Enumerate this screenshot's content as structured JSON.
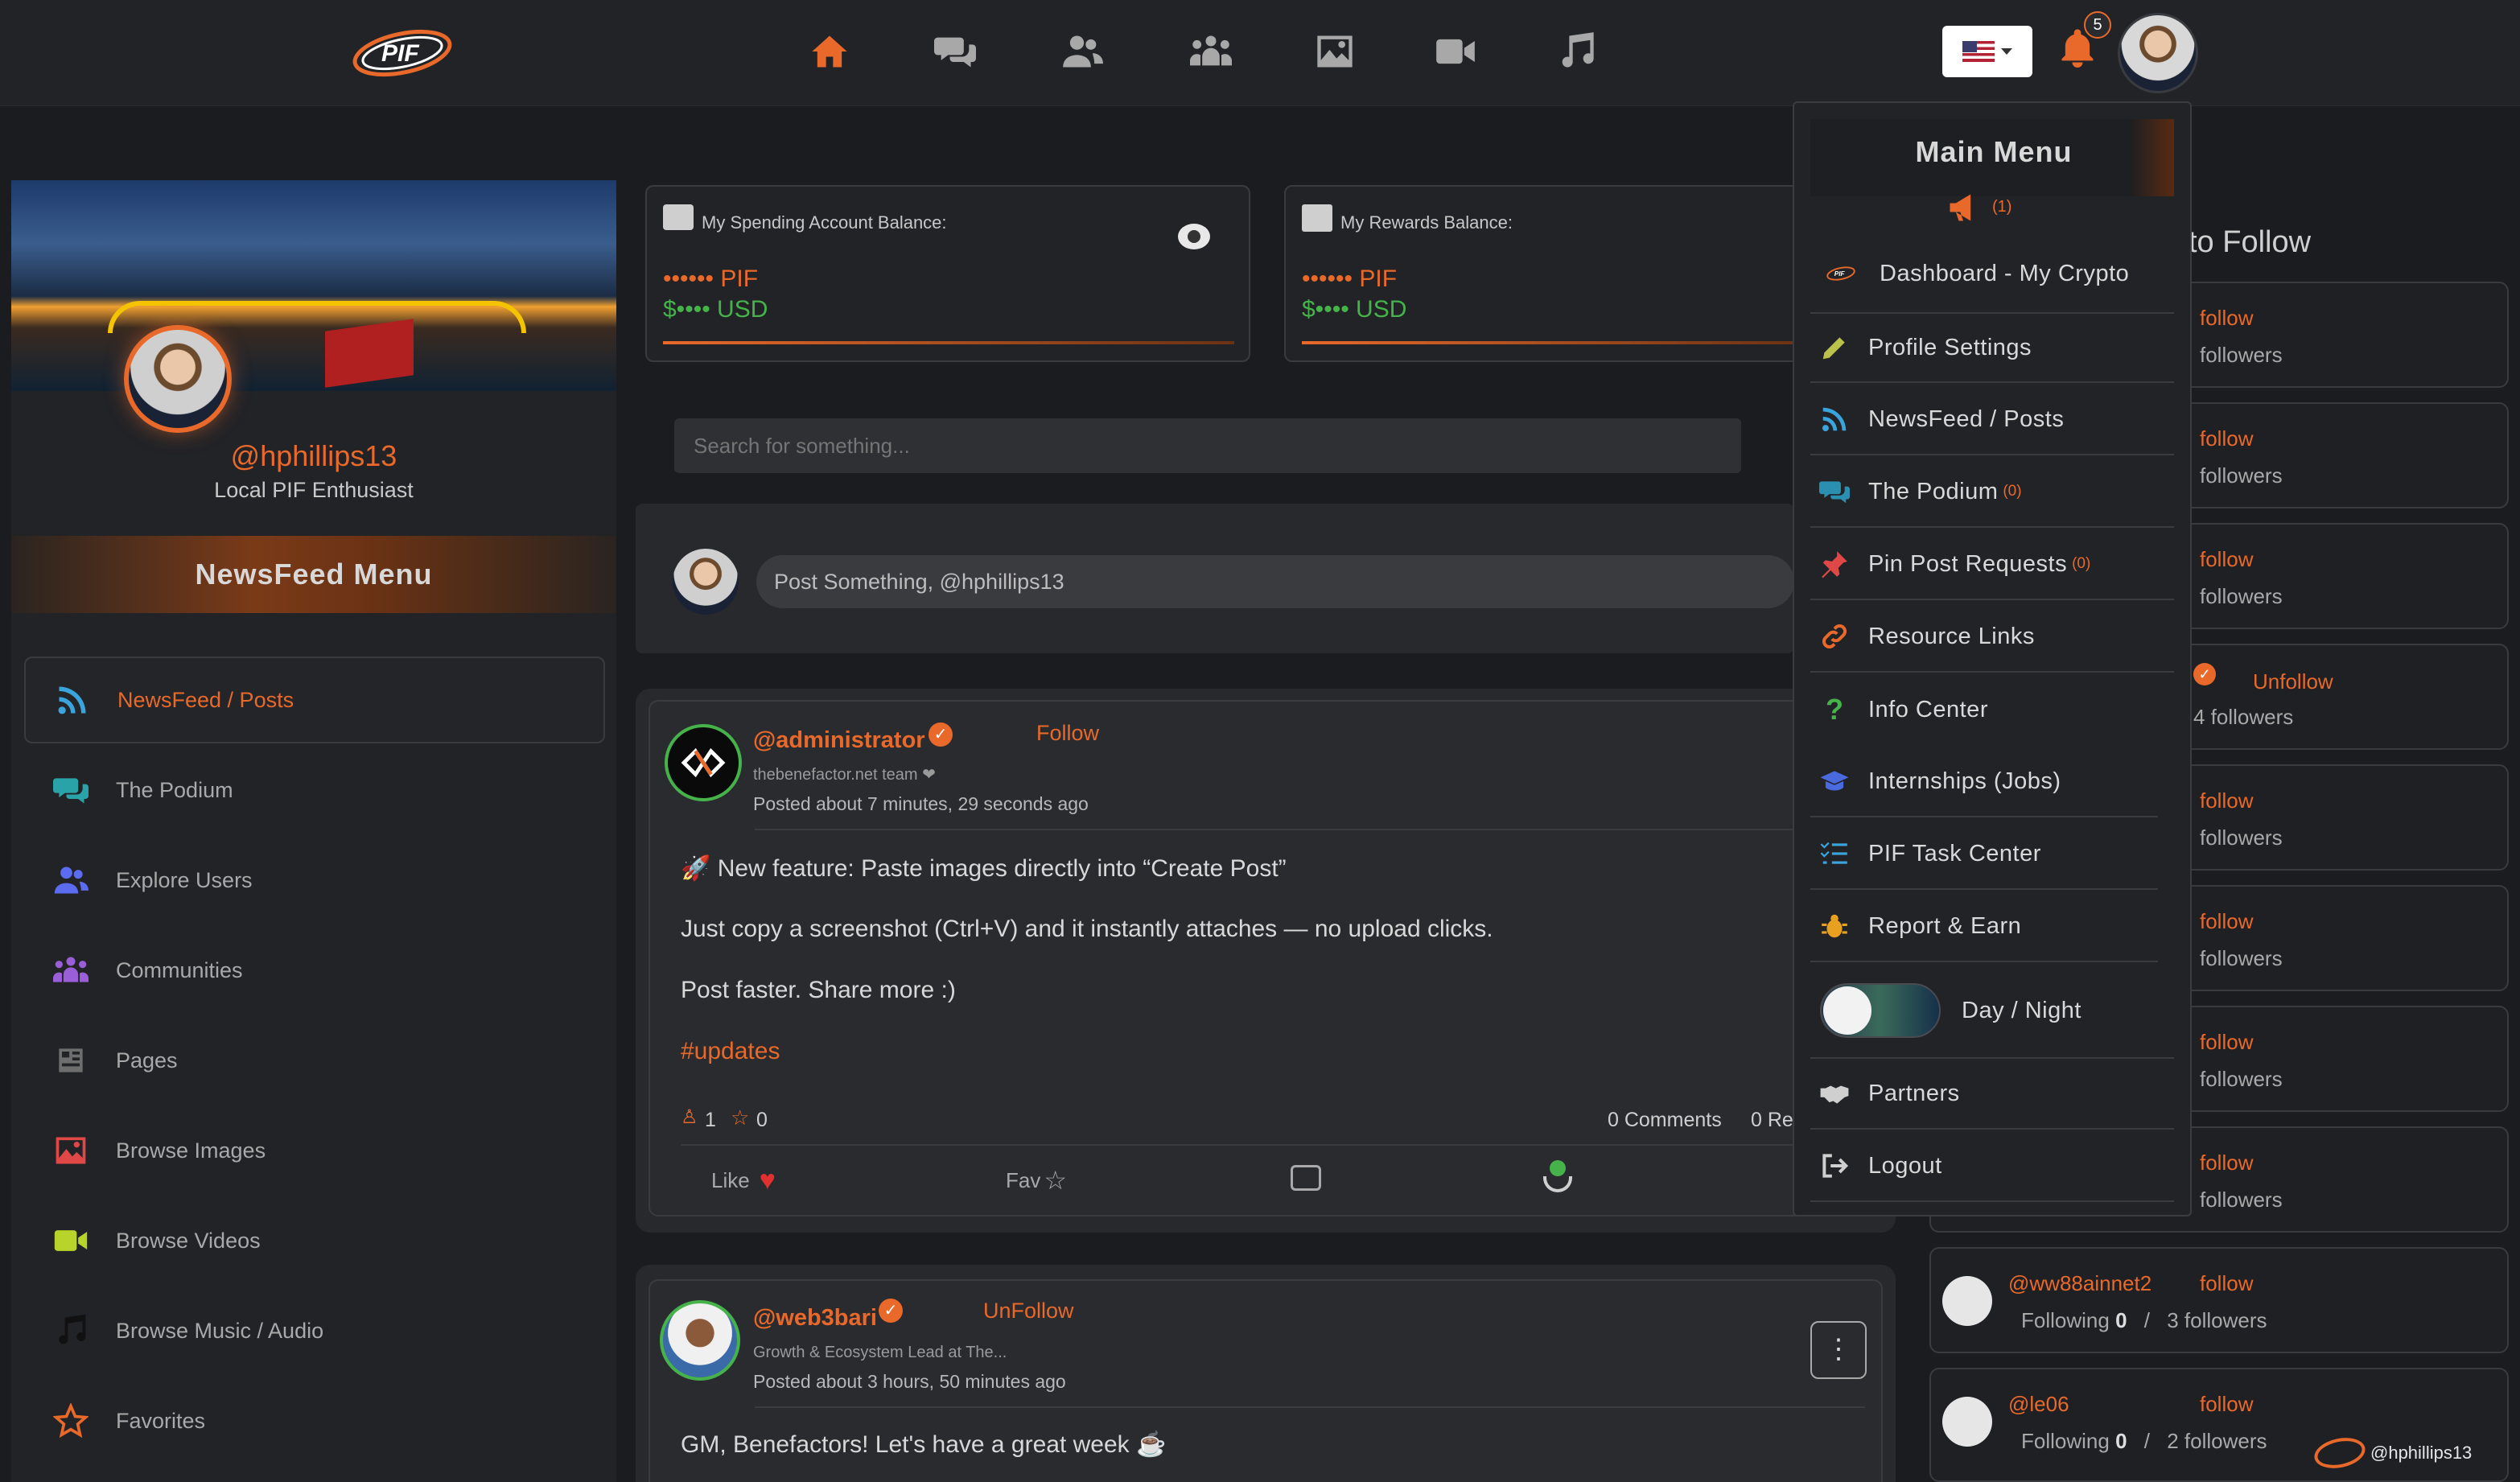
{
  "nav": {
    "logo_text": "PIF",
    "icons": [
      "home-icon",
      "chat-icon",
      "users-icon",
      "communities-icon",
      "image-icon",
      "video-icon",
      "music-icon"
    ],
    "notification_count": "5",
    "language_flag": "us-flag"
  },
  "balances": {
    "spending": {
      "label": "My Spending Account Balance:",
      "pif": "•••••• PIF",
      "usd": "$•••• USD"
    },
    "rewards": {
      "label": "My Rewards Balance:",
      "pif": "•••••• PIF",
      "usd": "$•••• USD"
    }
  },
  "profile": {
    "handle": "@hphillips13",
    "tagline": "Local PIF Enthusiast"
  },
  "newsfeed_menu": {
    "title": "NewsFeed Menu",
    "items": [
      {
        "label": "NewsFeed / Posts",
        "icon": "rss-icon",
        "active": true
      },
      {
        "label": "The Podium",
        "icon": "chat-icon"
      },
      {
        "label": "Explore Users",
        "icon": "users-icon"
      },
      {
        "label": "Communities",
        "icon": "communities-icon"
      },
      {
        "label": "Pages",
        "icon": "newspaper-icon"
      },
      {
        "label": "Browse Images",
        "icon": "image-icon"
      },
      {
        "label": "Browse Videos",
        "icon": "video-icon"
      },
      {
        "label": "Browse Music / Audio",
        "icon": "music-icon"
      },
      {
        "label": "Favorites",
        "icon": "star-icon"
      }
    ]
  },
  "search": {
    "placeholder": "Search for something..."
  },
  "composer": {
    "placeholder": "Post Something, @hphillips13"
  },
  "posts": [
    {
      "author": "@administrator",
      "follow_label": "Follow",
      "subtitle": "thebenefactor.net team ❤",
      "time": "Posted about 7 minutes, 29 seconds ago",
      "lines": [
        "🚀 New feature: Paste images directly into “Create Post”",
        "Just copy a screenshot (Ctrl+V) and it instantly attaches — no upload clicks.",
        "Post faster. Share more :)"
      ],
      "hashtag": "#updates",
      "likes": "1",
      "favs": "0",
      "comments": "0 Comments",
      "reposts": "0 Re",
      "like_label": "Like",
      "fav_label": "Fav"
    },
    {
      "author": "@web3bari",
      "follow_label": "UnFollow",
      "subtitle": "Growth & Ecosystem Lead at The...",
      "time": "Posted about 3 hours, 50 minutes ago",
      "lines": [
        "GM, Benefactors! Let's have a great week ☕"
      ]
    }
  ],
  "main_menu": {
    "title": "Main Menu",
    "announce_count": "(1)",
    "items": [
      {
        "label": "Dashboard - My Crypto",
        "icon": "pif-logo-icon"
      },
      {
        "label": "Profile Settings",
        "icon": "pencil-icon"
      },
      {
        "label": "NewsFeed / Posts",
        "icon": "rss-icon"
      },
      {
        "label": "The Podium",
        "icon": "chat-icon",
        "badge": "(0)"
      },
      {
        "label": "Pin Post Requests",
        "icon": "pin-icon",
        "badge": "(0)"
      },
      {
        "label": "Resource Links",
        "icon": "link-icon"
      },
      {
        "label": "Info Center",
        "icon": "question-icon"
      },
      {
        "label": "Internships (Jobs)",
        "icon": "graduation-cap-icon"
      },
      {
        "label": "PIF Task Center",
        "icon": "task-list-icon"
      },
      {
        "label": "Report & Earn",
        "icon": "bug-icon"
      },
      {
        "label": "Day / Night",
        "icon": "toggle-icon"
      },
      {
        "label": "Partners",
        "icon": "handshake-icon"
      },
      {
        "label": "Logout",
        "icon": "logout-icon"
      }
    ]
  },
  "who_to_follow": {
    "title": "to Follow",
    "rows": [
      {
        "name": "",
        "action": "follow",
        "stats": "followers"
      },
      {
        "name": "",
        "action": "follow",
        "stats": "followers"
      },
      {
        "name": "",
        "action": "follow",
        "stats": "followers"
      },
      {
        "name": "",
        "action": "Unfollow",
        "stats": "4 followers"
      },
      {
        "name": "",
        "action": "follow",
        "stats": "followers"
      },
      {
        "name": "",
        "action": "follow",
        "stats": "followers"
      },
      {
        "name": "",
        "action": "follow",
        "stats": "followers"
      },
      {
        "name": "",
        "action": "follow",
        "stats": "followers"
      },
      {
        "name": "@ww88ainnet2",
        "action": "follow",
        "following": "Following",
        "following_count": "0",
        "sep": "/",
        "stats": "3 followers"
      },
      {
        "name": "@le06",
        "action": "follow",
        "following": "Following",
        "following_count": "0",
        "sep": "/",
        "stats": "2 followers"
      }
    ]
  },
  "footer_handle": "@hphillips13",
  "colors": {
    "accent": "#e8692a",
    "green": "#45b34a",
    "bg": "#1b1c20",
    "panel": "#2a2b2f"
  }
}
